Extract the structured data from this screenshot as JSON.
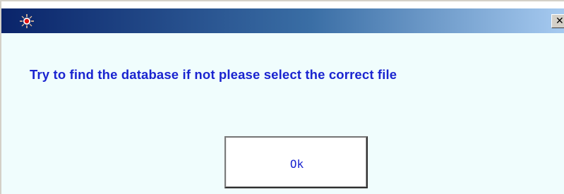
{
  "window": {
    "title": "",
    "icon": "red-circle-app-icon",
    "close_label": "✕"
  },
  "dialog": {
    "message": "Try to find the database if not please select the correct file",
    "ok_label": "Ok"
  },
  "colors": {
    "titlebar_start": "#0a246a",
    "titlebar_end": "#a6caf0",
    "background": "#f0fdfd",
    "message_text": "#1a24d0"
  }
}
